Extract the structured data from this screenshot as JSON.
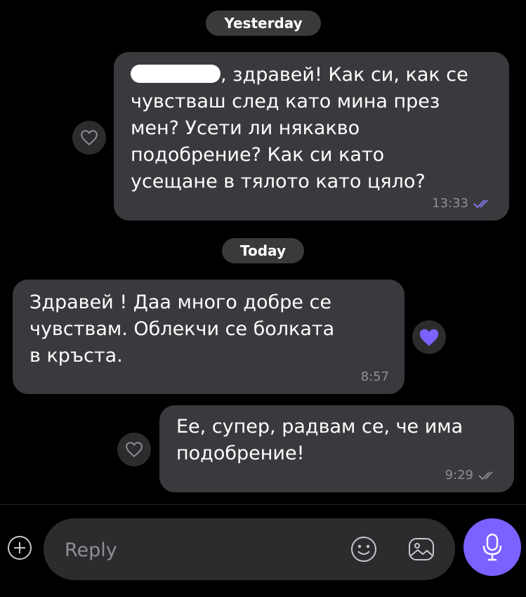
{
  "date_separators": {
    "yesterday": "Yesterday",
    "today": "Today"
  },
  "messages": [
    {
      "direction": "outgoing",
      "text_after_redaction": ", здравей! Как си, как се\nчувстваш след като мина през\nмен? Усети ли някакво\nподобрение? Как си като\nусещане в тялото като цяло?",
      "time": "13:33",
      "read": true,
      "reaction": "none"
    },
    {
      "direction": "incoming",
      "text": "Здравей ! Даа много добре се\nчувствам. Облекчи се болката\nв кръста.",
      "time": "8:57",
      "reaction": "heart-filled"
    },
    {
      "direction": "outgoing",
      "text": "Ее, супер, радвам се, че има\nподобрение!",
      "time": "9:29",
      "read": true,
      "reaction": "none"
    }
  ],
  "composer": {
    "placeholder": "Reply"
  },
  "icons": {
    "add": "plus-circle-icon",
    "emoji": "smiley-icon",
    "gallery": "image-icon",
    "mic": "microphone-icon",
    "react": "heart-outline-icon",
    "read": "double-check-icon"
  },
  "colors": {
    "accent": "#7b61ff",
    "bubble": "#3a3a3e",
    "background": "#000000"
  }
}
